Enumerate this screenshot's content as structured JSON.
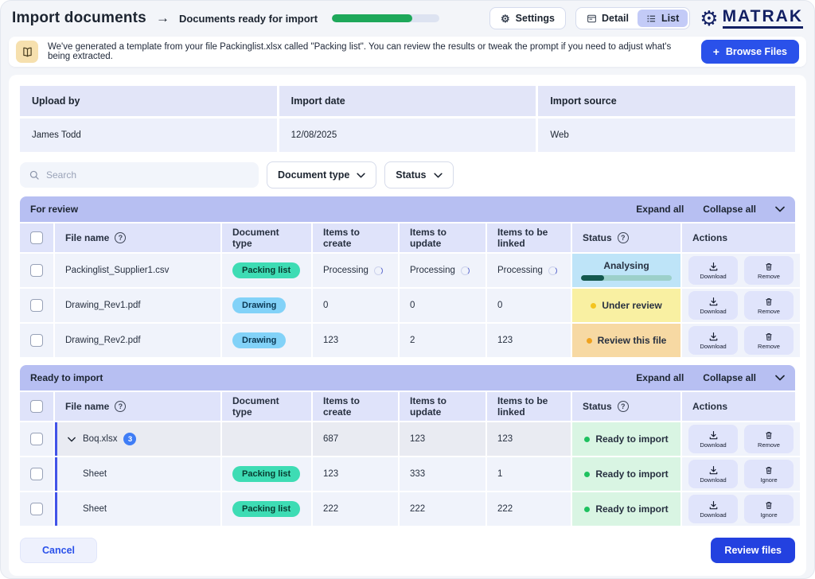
{
  "header": {
    "title": "Import documents",
    "arrow": "→",
    "subtitle": "Documents ready for import",
    "progress_percent": 75,
    "settings_label": "Settings",
    "view_toggle": {
      "detail_label": "Detail",
      "list_label": "List",
      "active": "List"
    },
    "brand_name": "MATRAK"
  },
  "banner": {
    "message": "We've generated a template from your file Packinglist.xlsx called \"Packing list\". You can review the results or tweak the prompt if you need to adjust what's being extracted.",
    "browse_plus": "+",
    "browse_label": "Browse Files"
  },
  "info_bar": {
    "columns": [
      "Upload by",
      "Import date",
      "Import source"
    ],
    "values": [
      "James Todd",
      "12/08/2025",
      "Web"
    ]
  },
  "filters": {
    "search_placeholder": "Search",
    "document_type_label": "Document type",
    "status_label": "Status"
  },
  "table": {
    "columns": [
      "File name",
      "Document type",
      "Items to create",
      "Items to update",
      "Items to be linked",
      "Status",
      "Actions"
    ],
    "expand_all_label": "Expand all",
    "collapse_all_label": "Collapse all"
  },
  "sections": [
    {
      "title": "For review",
      "rows": [
        {
          "file": "Packinglist_Supplier1.csv",
          "doc_type": "Packing list",
          "items_to_create": "Processing",
          "items_to_update": "Processing",
          "items_to_be_linked": "Processing",
          "status": "Analysing",
          "progress_percent": 25,
          "download_label": "Download",
          "remove_label": "Remove"
        },
        {
          "file": "Drawing_Rev1.pdf",
          "doc_type": "Drawing",
          "items_to_create": "0",
          "items_to_update": "0",
          "items_to_be_linked": "0",
          "status": "Under review",
          "download_label": "Download",
          "remove_label": "Remove"
        },
        {
          "file": "Drawing_Rev2.pdf",
          "doc_type": "Drawing",
          "items_to_create": "123",
          "items_to_update": "2",
          "items_to_be_linked": "123",
          "status": "Review this file",
          "download_label": "Download",
          "remove_label": "Remove"
        }
      ]
    },
    {
      "title": "Ready to import",
      "rows": [
        {
          "file": "Boq.xlsx",
          "sheet_count": "3",
          "doc_type": "",
          "items_to_create": "687",
          "items_to_update": "123",
          "items_to_be_linked": "123",
          "status": "Ready to import",
          "download_label": "Download",
          "remove_label": "Remove"
        },
        {
          "file": "Sheet",
          "doc_type": "Packing list",
          "items_to_create": "123",
          "items_to_update": "333",
          "items_to_be_linked": "1",
          "status": "Ready to import",
          "download_label": "Download",
          "remove_label": "Ignore"
        },
        {
          "file": "Sheet",
          "doc_type": "Packing list",
          "items_to_create": "222",
          "items_to_update": "222",
          "items_to_be_linked": "222",
          "status": "Ready to import",
          "download_label": "Download",
          "remove_label": "Ignore"
        }
      ]
    }
  ],
  "footer": {
    "cancel_label": "Cancel",
    "review_label": "Review files"
  },
  "colors": {
    "primary_blue": "#2a51ea",
    "brand_navy": "#121f63",
    "header_progress_green": "#1ea85a",
    "packing_list_pill": "#3edcb4",
    "drawing_pill": "#82d2f8",
    "analysing_bg": "#bee4f8",
    "analysing_bar_fill": "#14584e",
    "analysing_bar_track": "#9cd0ca",
    "under_review_bg": "#f9f0a2",
    "under_review_dot": "#f4c41f",
    "review_this_file_bg": "#f7d9a3",
    "review_this_file_dot": "#f0a21e",
    "ready_to_import_bg": "#d9f5e3",
    "ready_to_import_dot": "#1ec15f",
    "section_header_bg": "#b7bff2",
    "table_header_bg": "#dfe3fa",
    "row_bg": "#f0f3fb",
    "banner_icon_bg": "#f6e0ae"
  },
  "icons": {
    "settings": "gear",
    "brand": "gear",
    "banner": "open-book",
    "search": "magnifier",
    "detail": "panel",
    "list": "list-lines",
    "help": "question-circle",
    "processing": "spinner",
    "download": "arrow-into-tray",
    "remove": "trash",
    "expand": "chevron-down"
  }
}
